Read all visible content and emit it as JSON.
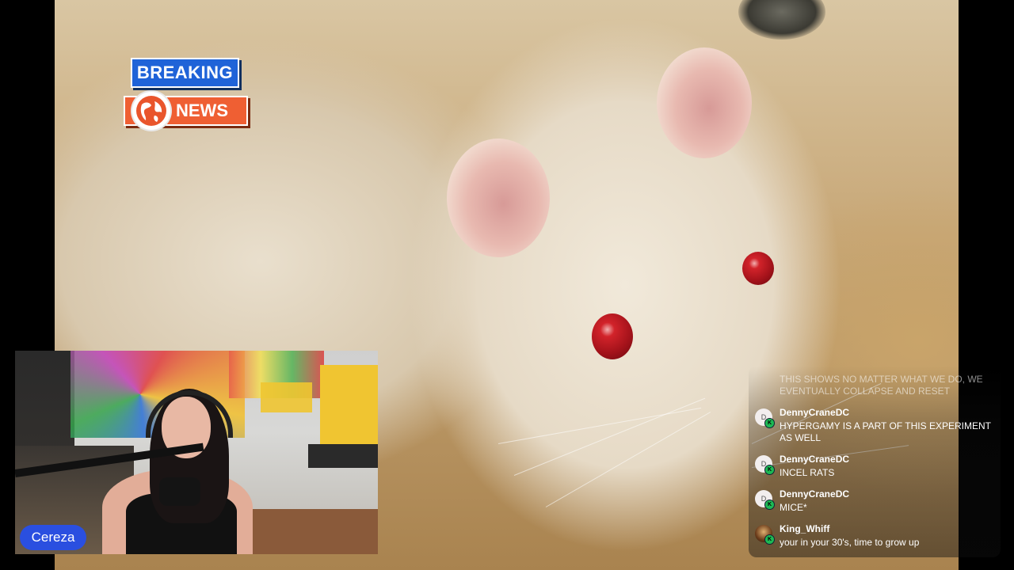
{
  "overlay": {
    "breaking_label": "BREAKING",
    "news_label": "NEWS"
  },
  "webcam": {
    "streamer_name": "Cereza"
  },
  "chat": {
    "faded_message": "THIS SHOWS NO MATTER WHAT WE DO, WE EVENTUALLY COLLAPSE AND RESET",
    "messages": [
      {
        "user": "DennyCraneDC",
        "avatar": "D",
        "text": "HYPERGAMY IS A PART OF THIS EXPERIMENT AS WELL"
      },
      {
        "user": "DennyCraneDC",
        "avatar": "D",
        "text": "INCEL RATS"
      },
      {
        "user": "DennyCraneDC",
        "avatar": "D",
        "text": "MICE*"
      },
      {
        "user": "King_Whiff",
        "avatar": "",
        "text": "your in your 30's, time to grow up"
      }
    ],
    "badge_color": "#1db954"
  }
}
